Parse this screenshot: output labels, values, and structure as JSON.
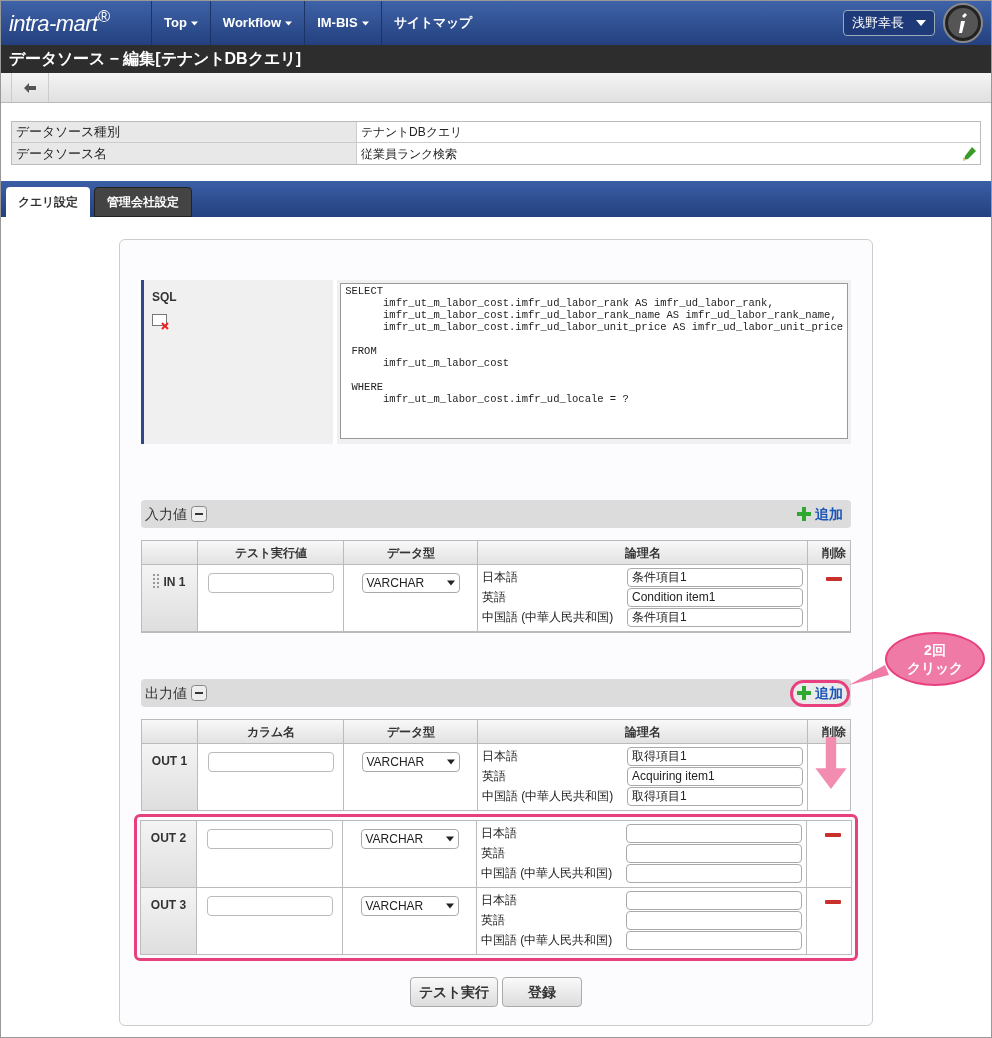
{
  "header": {
    "logo": "intra-mart$^{®}$",
    "menu": [
      {
        "label": "Top",
        "dropdown": true
      },
      {
        "label": "Workflow",
        "dropdown": true
      },
      {
        "label": "IM-BIS",
        "dropdown": true
      },
      {
        "label": "サイトマップ",
        "dropdown": false
      }
    ],
    "user": "浅野幸長"
  },
  "page_title": "データソース − 編集[テナントDBクエリ]",
  "info": [
    {
      "label": "データソース種別",
      "value": "テナントDBクエリ",
      "editable": false
    },
    {
      "label": "データソース名",
      "value": "従業員ランク検索",
      "editable": true
    }
  ],
  "tabs": [
    {
      "label": "クエリ設定",
      "selected": true
    },
    {
      "label": "管理会社設定",
      "selected": false
    }
  ],
  "sql": {
    "label": "SQL",
    "blocks": [
      [
        "SELECT",
        "      imfr_ut_m_labor_cost.imfr_ud_labor_rank AS imfr_ud_labor_rank,",
        "      imfr_ut_m_labor_cost.imfr_ud_labor_rank_name AS imfr_ud_labor_rank_name,",
        "      imfr_ut_m_labor_cost.imfr_ud_labor_unit_price AS imfr_ud_labor_unit_price"
      ],
      [
        " FROM",
        "      imfr_ut_m_labor_cost"
      ],
      [
        " WHERE",
        "      imfr_ut_m_labor_cost.imfr_ud_locale = ?"
      ]
    ]
  },
  "input_section": {
    "title": "入力値",
    "add": "追加",
    "columns": [
      "テスト実行値",
      "データ型",
      "論理名",
      "削除"
    ],
    "rows": [
      {
        "label": "IN 1",
        "type": "VARCHAR",
        "names": [
          {
            "lang": "日本語",
            "value": "条件項目1"
          },
          {
            "lang": "英語",
            "value": "Condition item1"
          },
          {
            "lang": "中国語 (中華人民共和国)",
            "value": "条件項目1"
          }
        ],
        "deletable": true,
        "highlighted": false
      }
    ]
  },
  "output_section": {
    "title": "出力値",
    "add": "追加",
    "columns": [
      "カラム名",
      "データ型",
      "論理名",
      "削除"
    ],
    "rows": [
      {
        "label": "OUT 1",
        "type": "VARCHAR",
        "names": [
          {
            "lang": "日本語",
            "value": "取得項目1"
          },
          {
            "lang": "英語",
            "value": "Acquiring item1"
          },
          {
            "lang": "中国語 (中華人民共和国)",
            "value": "取得項目1"
          }
        ],
        "deletable": false,
        "highlighted": false
      },
      {
        "label": "OUT 2",
        "type": "VARCHAR",
        "names": [
          {
            "lang": "日本語"
          },
          {
            "lang": "英語"
          },
          {
            "lang": "中国語 (中華人民共和国)"
          }
        ],
        "deletable": true,
        "highlighted": true
      },
      {
        "label": "OUT 3",
        "type": "VARCHAR",
        "names": [
          {
            "lang": "日本語"
          },
          {
            "lang": "英語"
          },
          {
            "lang": "中国語 (中華人民共和国)"
          }
        ],
        "deletable": true,
        "highlighted": true
      }
    ]
  },
  "callout": {
    "lines": [
      "2回",
      "クリック"
    ]
  },
  "buttons": [
    "テスト実行",
    "登録"
  ]
}
